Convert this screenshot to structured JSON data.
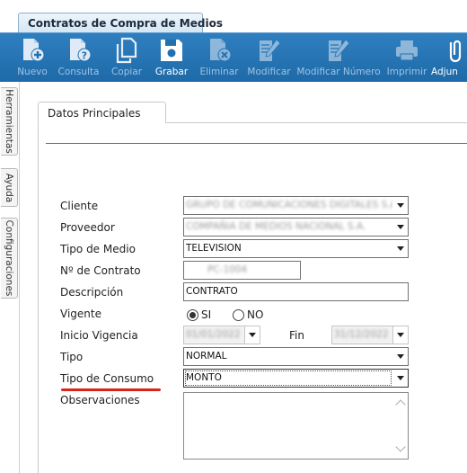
{
  "window": {
    "tab_title": "Contratos de Compra de Medios"
  },
  "toolbar": {
    "buttons": [
      {
        "label": "Nuevo",
        "icon": "new-document-icon"
      },
      {
        "label": "Consulta",
        "icon": "query-document-icon"
      },
      {
        "label": "Copiar",
        "icon": "copy-icon"
      },
      {
        "label": "Grabar",
        "icon": "save-icon"
      },
      {
        "label": "Eliminar",
        "icon": "delete-document-icon"
      },
      {
        "label": "Modificar",
        "icon": "edit-icon"
      },
      {
        "label": "Modificar Número",
        "icon": "edit-number-icon"
      },
      {
        "label": "Imprimir",
        "icon": "printer-icon"
      },
      {
        "label": "Adjun",
        "icon": "attach-icon"
      }
    ],
    "colors": {
      "bar": "#2170b0",
      "active_label": "#ffffff",
      "inactive_label": "#9ec3e4"
    }
  },
  "side_tabs": [
    "Herramientas",
    "Ayuda",
    "Configuraciones"
  ],
  "panel": {
    "tab_label": "Datos Principales"
  },
  "form": {
    "cliente": {
      "label": "Cliente",
      "value": "GRUPO DE COMUNICACIONES DIGITALES S.A."
    },
    "proveedor": {
      "label": "Proveedor",
      "value": "COMPAÑIA DE MEDIOS NACIONAL S.A."
    },
    "tipo_medio": {
      "label": "Tipo de Medio",
      "value": "TELEVISION"
    },
    "numero_contrato": {
      "label": "Nº de Contrato",
      "value": "PC-1004"
    },
    "descripcion": {
      "label": "Descripción",
      "value": "CONTRATO"
    },
    "vigente": {
      "label": "Vigente",
      "options": [
        "SI",
        "NO"
      ],
      "selected": "SI"
    },
    "inicio_vigencia": {
      "label": "Inicio Vigencia",
      "value": "01/01/2022"
    },
    "fin": {
      "label": "Fin",
      "value": "31/12/2022"
    },
    "tipo": {
      "label": "Tipo",
      "value": "NORMAL"
    },
    "tipo_consumo": {
      "label": "Tipo de Consumo",
      "value": "MONTO"
    },
    "observaciones": {
      "label": "Observaciones",
      "value": ""
    }
  },
  "highlight_color": "#d9261c"
}
